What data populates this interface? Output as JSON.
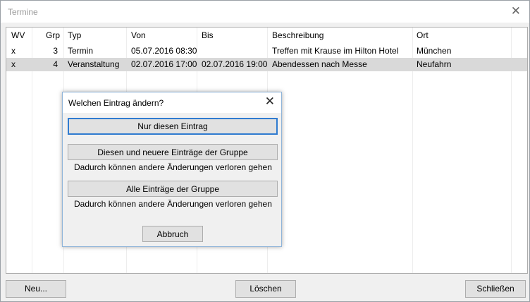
{
  "window": {
    "title": "Termine",
    "close_glyph": "✕"
  },
  "grid": {
    "columns": [
      "WV",
      "Grp",
      "Typ",
      "Von",
      "Bis",
      "Beschreibung",
      "Ort"
    ],
    "rows": [
      {
        "wv": "x",
        "grp": "3",
        "typ": "Termin",
        "von": "05.07.2016 08:30",
        "bis": "",
        "beschreibung": "Treffen mit Krause im Hilton Hotel",
        "ort": "München",
        "selected": false
      },
      {
        "wv": "x",
        "grp": "4",
        "typ": "Veranstaltung",
        "von": "02.07.2016 17:00",
        "bis": "02.07.2016 19:00",
        "beschreibung": "Abendessen nach Messe",
        "ort": "Neufahrn",
        "selected": true
      }
    ]
  },
  "dialog": {
    "title": "Welchen Eintrag ändern?",
    "close_glyph": "✕",
    "only_this_label": "Nur diesen Eintrag",
    "this_and_newer_label": "Diesen und neuere Einträge der Gruppe",
    "this_and_newer_note": "Dadurch können andere Änderungen verloren gehen",
    "all_label": "Alle Einträge der Gruppe",
    "all_note": "Dadurch können andere Änderungen verloren gehen",
    "cancel_label": "Abbruch"
  },
  "footer": {
    "new_label": "Neu...",
    "delete_label": "Löschen",
    "close_label": "Schließen"
  },
  "colors": {
    "selection": "#d9d9d9",
    "focus_border": "#2f7bd0",
    "dialog_border": "#8fb4d9"
  }
}
